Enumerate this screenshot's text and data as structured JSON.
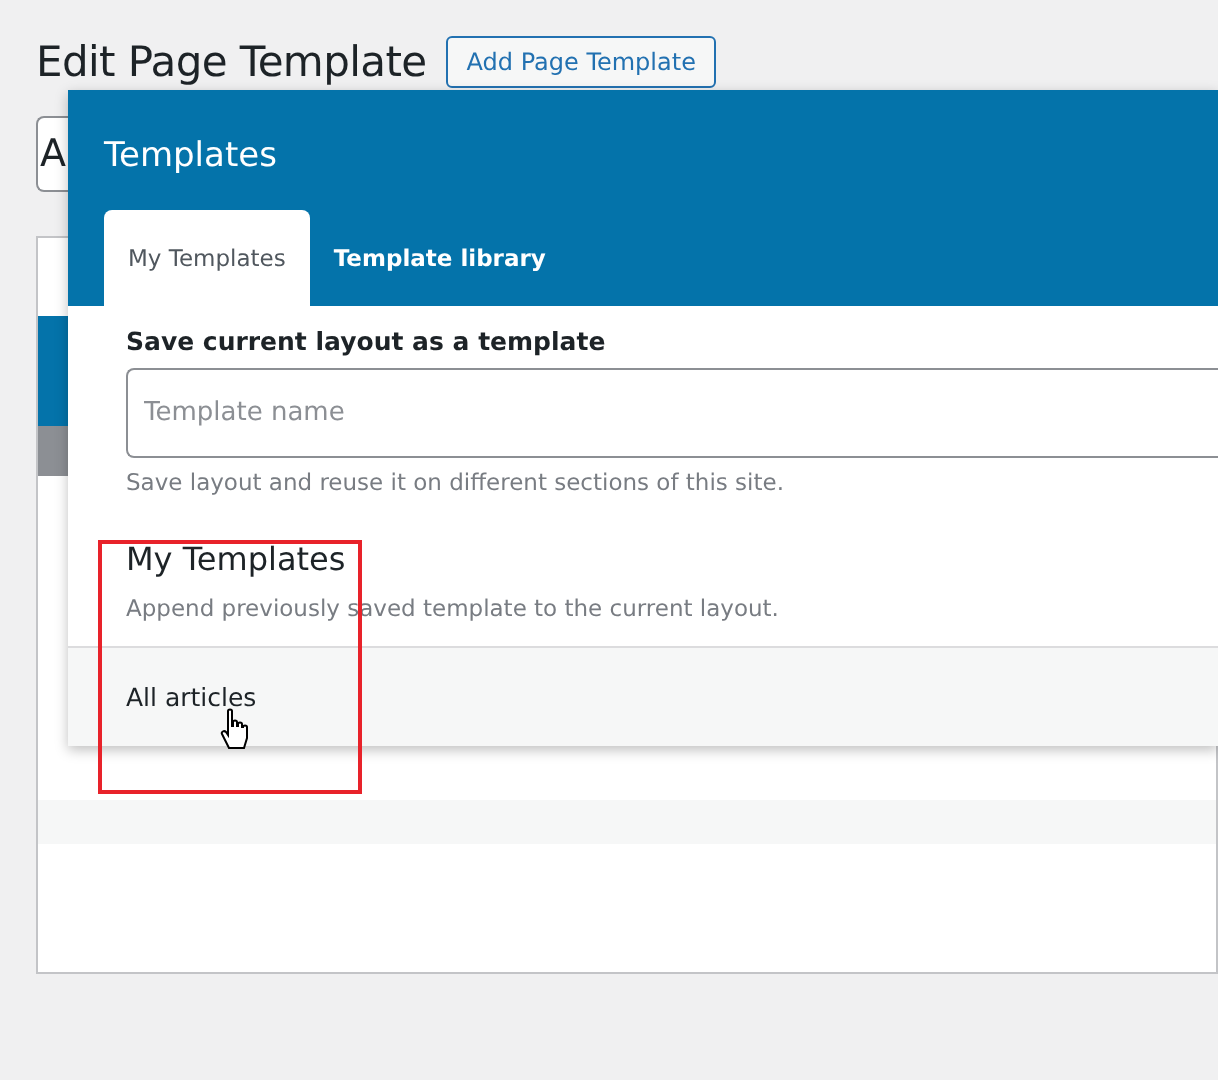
{
  "page": {
    "title": "Edit Page Template",
    "add_button": "Add Page Template",
    "title_field": {
      "value": "A"
    }
  },
  "modal": {
    "title": "Templates",
    "tabs": [
      {
        "label": "My Templates",
        "selected": true
      },
      {
        "label": "Template library",
        "selected": false
      }
    ],
    "save_section": {
      "heading": "Save current layout as a template",
      "field": {
        "placeholder": "Template name"
      },
      "help": "Save layout and reuse it on different sections of this site."
    },
    "my_templates": {
      "heading": "My Templates",
      "description": "Append previously saved template to the current layout.",
      "items": [
        "All articles"
      ]
    }
  }
}
